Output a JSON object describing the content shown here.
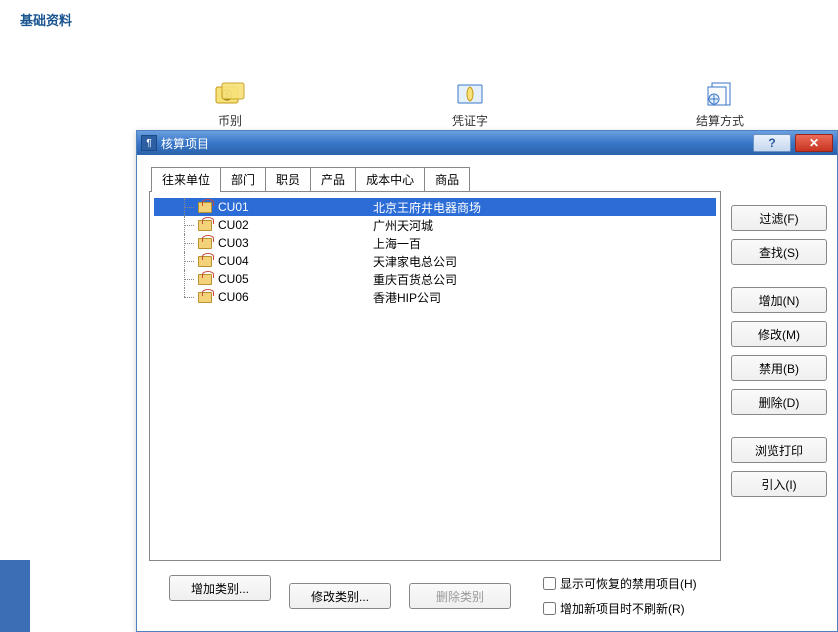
{
  "page": {
    "title": "基础资料"
  },
  "bg": {
    "icon1_label": "币别",
    "icon2_label": "凭证字",
    "icon3_label": "结算方式"
  },
  "dialog": {
    "title": "核算项目",
    "help_glyph": "?",
    "close_glyph": "✕"
  },
  "tabs": [
    {
      "label": "往来单位",
      "active": true
    },
    {
      "label": "部门"
    },
    {
      "label": "职员"
    },
    {
      "label": "产品"
    },
    {
      "label": "成本中心"
    },
    {
      "label": "商品"
    }
  ],
  "items": [
    {
      "code": "CU01",
      "name": "北京王府井电器商场",
      "selected": true
    },
    {
      "code": "CU02",
      "name": "广州天河城"
    },
    {
      "code": "CU03",
      "name": "上海一百"
    },
    {
      "code": "CU04",
      "name": "天津家电总公司"
    },
    {
      "code": "CU05",
      "name": "重庆百货总公司"
    },
    {
      "code": "CU06",
      "name": "香港HIP公司"
    }
  ],
  "side_buttons": {
    "filter": "过滤(F)",
    "find": "查找(S)",
    "add": "增加(N)",
    "edit": "修改(M)",
    "disable": "禁用(B)",
    "delete": "删除(D)",
    "print": "浏览打印",
    "import": "引入(I)"
  },
  "bottom": {
    "add_cat": "增加类别...",
    "edit_cat": "修改类别...",
    "del_cat": "删除类别",
    "check1": "显示可恢复的禁用项目(H)",
    "check2": "增加新项目时不刷新(R)"
  }
}
